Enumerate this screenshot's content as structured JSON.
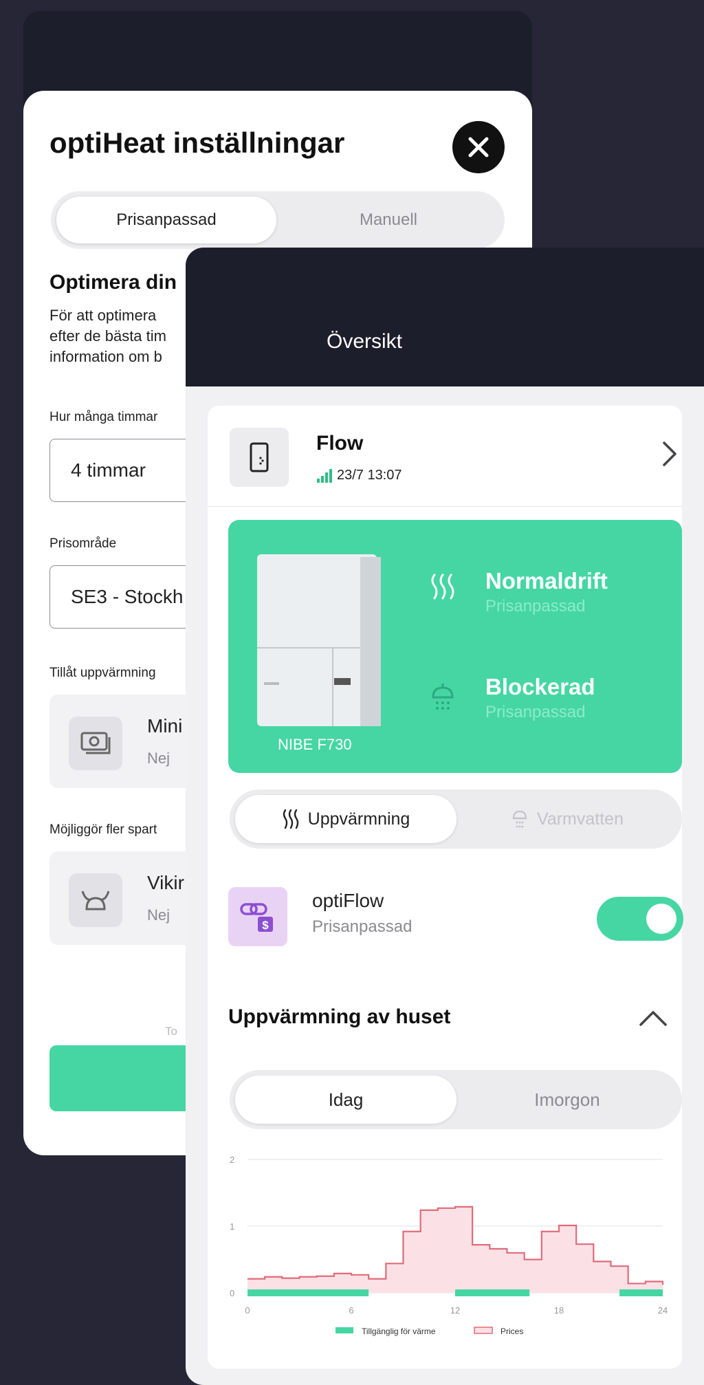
{
  "settings_sheet": {
    "title": "optiHeat inställningar",
    "tabs": [
      "Prisanpassad",
      "Manuell"
    ],
    "heading": "Optimera din",
    "paragraph_lines": [
      "För att optimera",
      "efter de bästa tim",
      "information om b"
    ],
    "hours_label": "Hur många timmar",
    "hours_value": "4 timmar",
    "area_label": "Prisområde",
    "area_value": "SE3 - Stockh",
    "allow_label": "Tillåt uppvärmning",
    "option1": {
      "title": "Mini",
      "value": "Nej",
      "icon": "money-icon"
    },
    "enable_label": "Möjliggör fler spart",
    "option2": {
      "title": "Vikir",
      "value": "Nej",
      "icon": "viking-helmet-icon"
    },
    "footer_text": "To"
  },
  "overview": {
    "title": "Översikt",
    "device": {
      "name": "Flow",
      "timestamp": "23/7 13:07",
      "icon": "device-icon"
    },
    "heat_pump": {
      "model": "NIBE F730",
      "heating_status": "Normaldrift",
      "heating_mode": "Prisanpassad",
      "water_status": "Blockerad",
      "water_mode": "Prisanpassad"
    },
    "mode_tabs": [
      "Uppvärmning",
      "Varmvatten"
    ],
    "optiflow": {
      "title": "optiFlow",
      "subtitle": "Prisanpassad",
      "enabled": true
    },
    "section_title": "Uppvärmning av huset",
    "day_tabs": [
      "Idag",
      "Imorgon"
    ]
  },
  "colors": {
    "accent": "#45d6a4",
    "dark": "#1d1e2b",
    "price_line": "#e06b7a",
    "price_fill": "#fbe1e5"
  },
  "chart_data": {
    "type": "area",
    "title": "",
    "xlabel": "",
    "ylabel": "",
    "x_ticks": [
      "0",
      "6",
      "12",
      "18",
      "24"
    ],
    "y_ticks": [
      "0",
      "1",
      "2"
    ],
    "xlim": [
      0,
      24
    ],
    "ylim": [
      0,
      2
    ],
    "grid": true,
    "legend_position": "bottom",
    "series": [
      {
        "name": "Prices",
        "style": "step-area",
        "x": [
          0,
          1,
          2,
          3,
          4,
          5,
          6,
          7,
          8,
          9,
          10,
          11,
          12,
          13,
          14,
          15,
          16,
          17,
          18,
          19,
          20,
          21,
          22,
          23,
          24
        ],
        "values": [
          0.21,
          0.24,
          0.22,
          0.24,
          0.25,
          0.29,
          0.27,
          0.21,
          0.44,
          0.92,
          1.24,
          1.27,
          1.29,
          0.72,
          0.66,
          0.6,
          0.5,
          0.92,
          1.01,
          0.73,
          0.47,
          0.4,
          0.14,
          0.17,
          0.12
        ]
      },
      {
        "name": "Tillgänglig för värme",
        "style": "bands",
        "ranges": [
          [
            0,
            7
          ],
          [
            12,
            16.3
          ],
          [
            21.5,
            24
          ]
        ]
      }
    ]
  }
}
